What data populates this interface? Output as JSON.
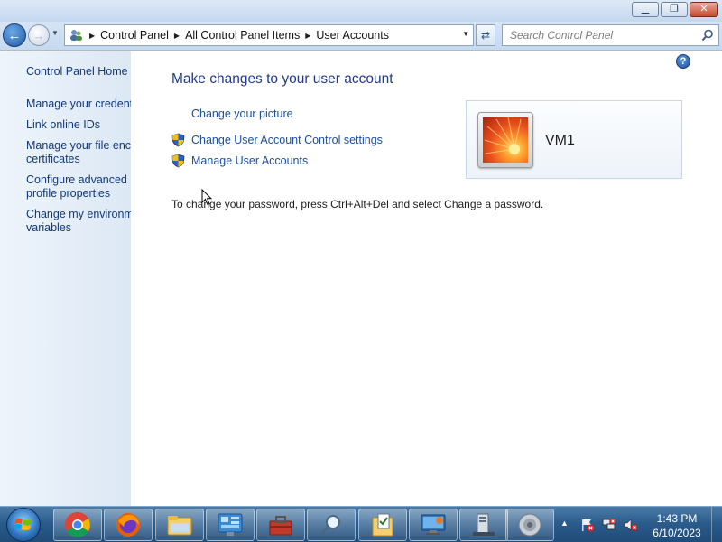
{
  "window": {
    "caption": {
      "minimize": "▁",
      "restore": "❐",
      "close": "✕"
    }
  },
  "navigation": {
    "breadcrumbs": [
      "Control Panel",
      "All Control Panel Items",
      "User Accounts"
    ],
    "search_placeholder": "Search Control Panel"
  },
  "sidebar": {
    "items": [
      {
        "label": "Control Panel Home"
      },
      {
        "label": "Manage your credentials"
      },
      {
        "label": "Link online IDs"
      },
      {
        "label": "Manage your file encryption",
        "label2": "certificates"
      },
      {
        "label": "Configure advanced user",
        "label2": "profile properties"
      },
      {
        "label": "Change my environment",
        "label2": "variables"
      }
    ]
  },
  "main": {
    "title": "Make changes to your user account",
    "links": [
      {
        "label": "Change your picture",
        "icon": "none"
      },
      {
        "label": "Change User Account Control settings",
        "icon": "shield-icon"
      },
      {
        "label": "Manage User Accounts",
        "icon": "shield-icon"
      }
    ],
    "password_note": "To change your password, press Ctrl+Alt+Del and select Change a password.",
    "user": {
      "name": "VM1"
    }
  },
  "taskbar": {
    "apps": [
      "chrome-icon",
      "firefox-icon",
      "file-explorer-icon",
      "control-panel-icon",
      "toolbox-icon",
      "search-magnifier-icon",
      "folder-document-icon",
      "remote-desktop-icon",
      "server-icon",
      "speaker-icon"
    ],
    "clock": {
      "time": "1:43 PM",
      "date": "6/10/2023"
    }
  },
  "colors": {
    "link": "#1c4f9c",
    "title": "#1e3a8a",
    "taskbar": "#2c5c8c"
  }
}
